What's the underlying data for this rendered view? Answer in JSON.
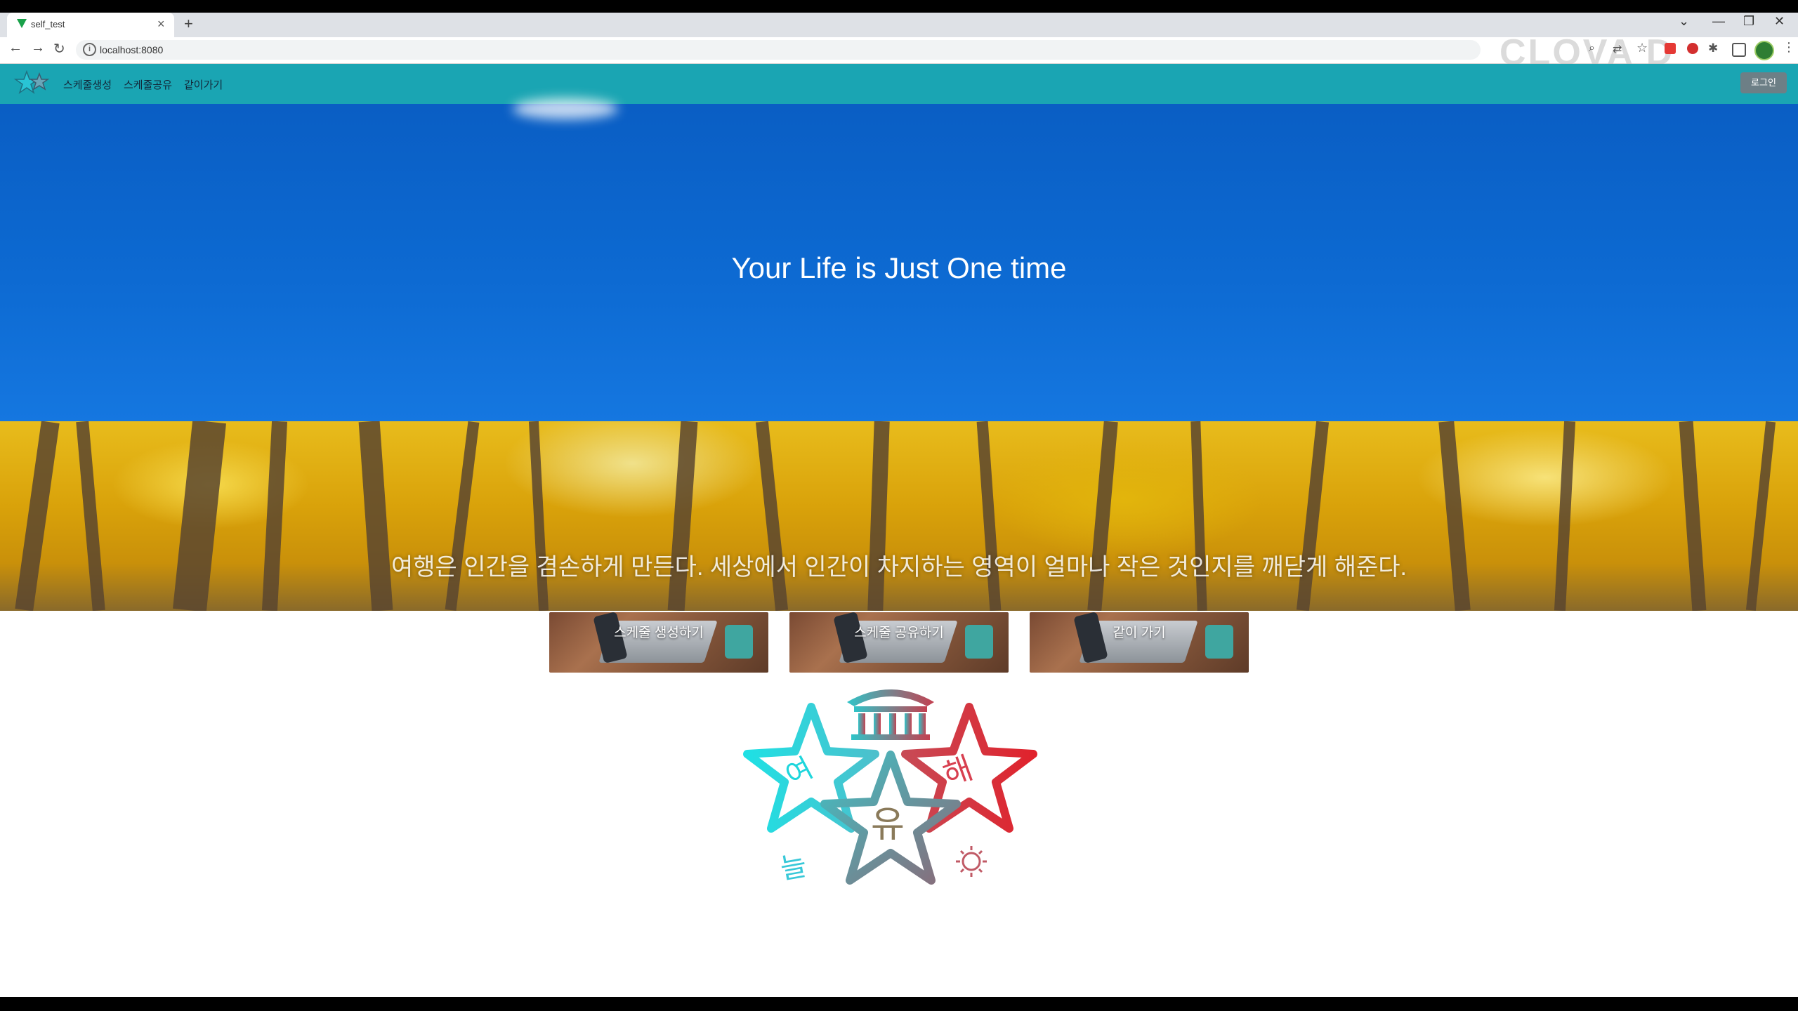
{
  "browser": {
    "tab_title": "self_test",
    "tab_close": "×",
    "new_tab": "+",
    "url": "localhost:8080",
    "window_controls": [
      "⌄",
      "—",
      "❐",
      "✕"
    ],
    "watermark": "CLOVA D"
  },
  "site": {
    "menu": [
      "스케줄생성",
      "스케줄공유",
      "같이가기"
    ],
    "login": "로그인"
  },
  "hero": {
    "title": "Your Life is Just One time"
  },
  "forest": {
    "quote": "여행은 인간을 겸손하게 만든다. 세상에서 인간이 차지하는 영역이 얼마나 작은 것인지를 깨닫게 해준다."
  },
  "cards": [
    {
      "label": "스케줄 생성하기"
    },
    {
      "label": "스케줄 공유하기"
    },
    {
      "label": "같이 가기"
    }
  ],
  "logo": {
    "chars": [
      "여",
      "유",
      "해",
      "늘"
    ]
  }
}
